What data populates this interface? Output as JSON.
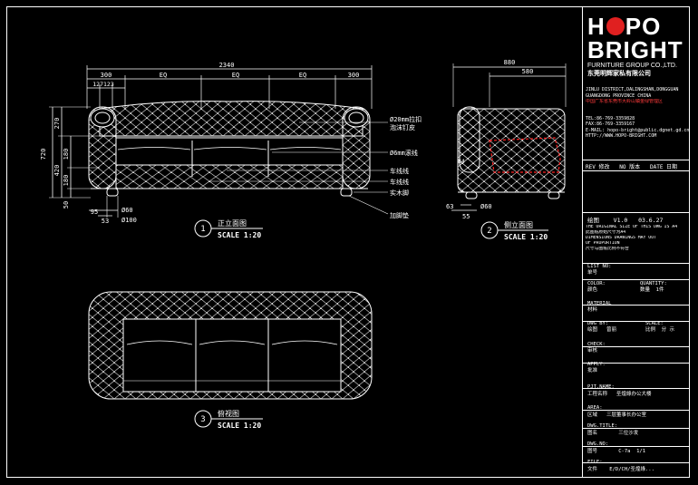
{
  "dims": {
    "overall_width": "2340",
    "arm": "300",
    "eq1": "EQ",
    "eq2": "EQ",
    "eq3": "EQ",
    "arm2": "300",
    "arm_detail": "127123",
    "total_h": "720",
    "upper_h": "270",
    "seat_h": "420",
    "back_h": "180",
    "cushion_h": "180",
    "foot_h": "50",
    "foot_w1": "95",
    "foot_w2": "53",
    "foot_d1": "Ø60",
    "foot_d2": "Ø100",
    "side_depth": "880",
    "side_seat": "580",
    "side_84": "84",
    "side_63": "63",
    "side_55": "55",
    "side_d": "Ø60"
  },
  "callouts": {
    "c1a": "Ø20mm拉扣",
    "c1b": "泡沫钉皮",
    "c2": "Ø6mm滚线",
    "c3": "车线线",
    "c4": "车线线",
    "c5": "实木脚",
    "c6": "加脚垫"
  },
  "views": {
    "front_num": "1",
    "front_title": "正立面图",
    "front_scale": "SCALE 1:20",
    "side_num": "2",
    "side_title": "侧立面图",
    "side_scale": "SCALE 1:20",
    "top_num": "3",
    "top_title": "俯视图",
    "top_scale": "SCALE 1:20"
  },
  "logo": {
    "line1_a": "H",
    "line1_b": "PO",
    "line2": "BRIGHT",
    "line3": "FURNITURE GROUP CO.,LTD.",
    "line4": "东莞明辉家私有限公司"
  },
  "title_block": {
    "addr1": "JINLU DISTRICT,DALINGSHAN,DONGGUAN",
    "addr2": "GUANGDONG PROVINCE CHINA",
    "addr3": "中国广东省东莞市大岭山镇金绿管理区",
    "tel": "TEL:86-769-3359828",
    "fax": "FAX:86-769-3359167",
    "email": "E-MAIL: hopo-bright@public.dgnet.gd.cn",
    "http": "HTTP://WWW.HOPO-BRIGHT.COM",
    "rev": "REV 修改",
    "no": "NO 版本",
    "date": "DATE 日期",
    "drafter": "绘图",
    "version": "V1.0",
    "date_val": "03.6.27",
    "note1": "THE ORIGINAL SIZE OF THIS DWG IS A4",
    "note2": "此图纸原始尺寸为A4",
    "note3": "DIMENSIONS DRAWINGS MAY OUT",
    "note4": "OF PROPORTION",
    "note5": "尺寸与图纸比例不符合",
    "list_no_label": "LIST NO:",
    "list_no_cn": "单号",
    "color_label": "COLOR:",
    "color_cn": "颜色",
    "qty_label": "QUANTITY:",
    "qty_cn": "数量",
    "qty_val": "1件",
    "material_label": "MATERIAL",
    "material_cn": "材料",
    "dwg_by_label": "DWG BY:",
    "dwg_by_cn": "绘图",
    "dwg_by_val": "曾丽",
    "scale_label": "SCALE:",
    "scale_cn": "比例",
    "scale_val": "分 示",
    "check_label": "CHECK:",
    "check_cn": "审核",
    "apply_label": "APPLY:",
    "apply_cn": "批准",
    "prj_label": "PJT.NAME:",
    "prj_cn": "工程名称",
    "prj_val": "圣煌綠办公大楼",
    "area_label": "AREA:",
    "area_cn": "区域",
    "area_val": "三层董事长办公室",
    "title_label": "DWG.TITLE:",
    "title_cn": "图名",
    "title_val": "三位沙发",
    "dwg_no_label": "DWG.NO:",
    "dwg_no_cn": "图号",
    "dwg_no_val": "C-7a",
    "dwg_no_sheet": "1/1",
    "file_label": "FILE:",
    "file_cn": "文件",
    "file_val": "E/D/CH/圣煌綠..."
  }
}
